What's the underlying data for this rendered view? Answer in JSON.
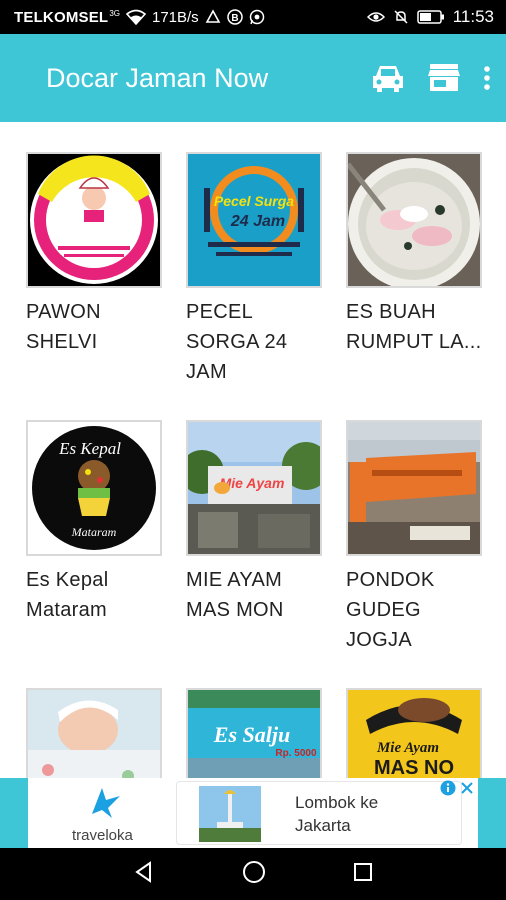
{
  "status_bar": {
    "carrier": "TELKOMSEL",
    "network": "3G",
    "speed": "171B/s",
    "time": "11:53",
    "icons": [
      "wifi-icon",
      "upload-icon",
      "mail-icon",
      "b-icon",
      "whatsapp-icon",
      "eye-icon",
      "mute-icon",
      "battery-icon"
    ]
  },
  "app_bar": {
    "title": "Docar Jaman Now",
    "actions": [
      "car-icon",
      "store-icon",
      "more-vert-icon"
    ],
    "color": "#3ec6d6"
  },
  "items": [
    {
      "label": "PAWON SHELVI",
      "image": "pawon-shelvie-logo"
    },
    {
      "label": "PECEL SORGA 24 JAM",
      "image": "pecel-surga-logo"
    },
    {
      "label": "ES BUAH RUMPUT LA...",
      "image": "es-buah-bowl-photo"
    },
    {
      "label": "Es Kepal Mataram",
      "image": "es-kepal-logo"
    },
    {
      "label": "MIE AYAM MAS MON",
      "image": "mie-ayam-shop-photo"
    },
    {
      "label": "PONDOK GUDEG JOGJA",
      "image": "pondok-gudeg-photo"
    },
    {
      "label": "",
      "image": "baby-photo"
    },
    {
      "label": "",
      "image": "es-salju-sign"
    },
    {
      "label": "",
      "image": "mie-ayam-mas-no-logo"
    }
  ],
  "thumb_text": {
    "pawon": "Pawon Shelvie",
    "pecel_1": "Pecel Surga",
    "pecel_2": "24 Jam",
    "kepal_1": "Es Kepal",
    "kepal_2": "Mataram",
    "mie": "Mie Ayam",
    "salju": "Es Salju",
    "salju_price": "Rp. 5000",
    "mas_no_1": "Mie Ayam",
    "mas_no_2": "MAS NO"
  },
  "ad": {
    "brand": "traveloka",
    "headline_line1": "Lombok ke",
    "headline_line2": "Jakarta",
    "badges": [
      "info-icon",
      "close-icon"
    ]
  },
  "nav_bar": [
    "back-icon",
    "home-icon",
    "recents-icon"
  ]
}
